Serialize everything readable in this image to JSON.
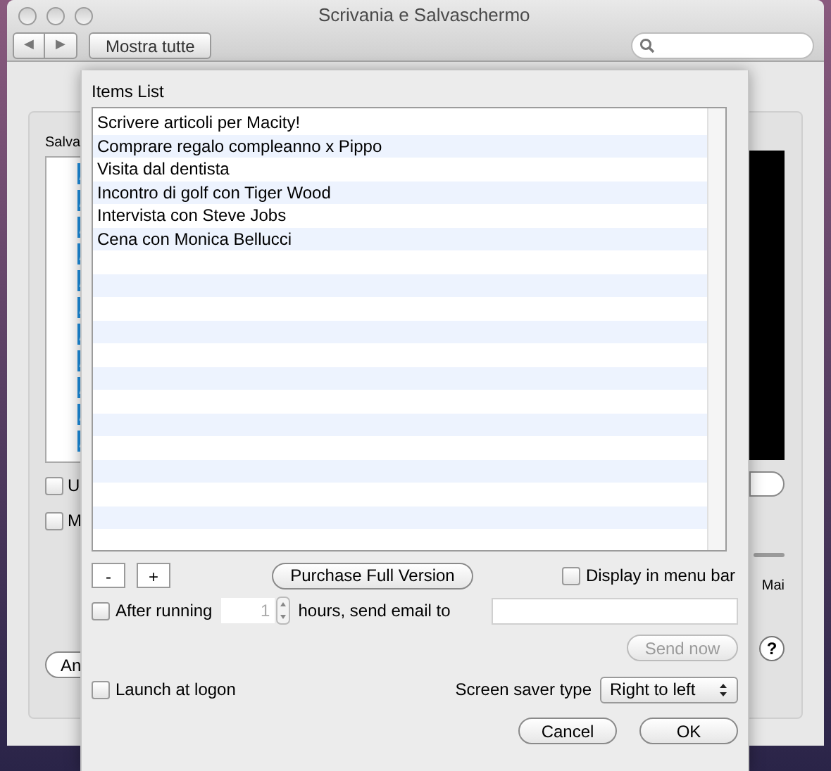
{
  "window": {
    "title": "Scrivania e Salvaschermo"
  },
  "toolbar": {
    "back": "◀",
    "forward": "▶",
    "show_all": "Mostra tutte"
  },
  "background": {
    "list_label": "Salva",
    "checkboxes": [
      {
        "label": "U",
        "checked": false
      },
      {
        "label": "M",
        "checked": false
      }
    ],
    "button": "An",
    "slider_label": "Mai",
    "help": "?"
  },
  "sheet": {
    "title": "Items List",
    "items": [
      {
        "text": "Scrivere articoli per Macity!"
      },
      {
        "text": "Comprare regalo compleanno x Pippo"
      },
      {
        "text": "Visita dal dentista"
      },
      {
        "text": "Incontro di golf con Tiger Wood"
      },
      {
        "text": "Intervista con Steve Jobs"
      },
      {
        "text": "Cena con Monica Bellucci"
      }
    ],
    "remove": "-",
    "add": "+",
    "purchase": "Purchase Full Version",
    "display_in_menu_bar": {
      "label": "Display in menu bar",
      "checked": false
    },
    "after_running": {
      "label": "After running",
      "checked": false
    },
    "hours": {
      "value": "1",
      "disabled": true
    },
    "send_email_label": "hours, send email to",
    "send_now": {
      "label": "Send now",
      "disabled": true
    },
    "launch_at_logon": {
      "label": "Launch at logon",
      "checked": false
    },
    "screen_saver_type": {
      "label": "Screen saver type",
      "value": "Right to left"
    },
    "cancel": "Cancel",
    "ok": "OK"
  }
}
